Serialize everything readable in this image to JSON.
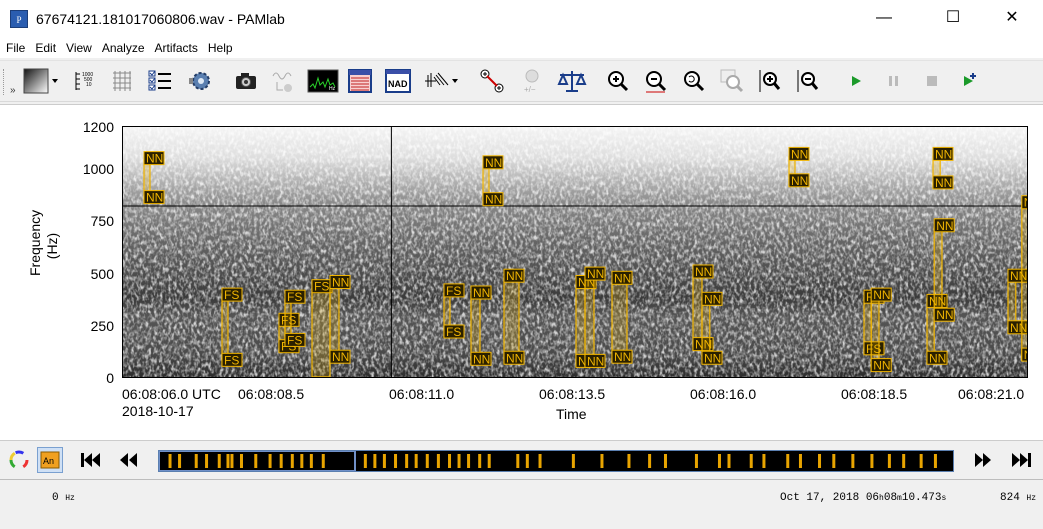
{
  "window": {
    "title": "67674121.181017060806.wav - PAMlab",
    "app_icon": "PAMlab-icon",
    "minimize": "—",
    "maximize": "☐",
    "close": "✕"
  },
  "menu": [
    "File",
    "Edit",
    "View",
    "Analyze",
    "Artifacts",
    "Help"
  ],
  "toolbar": [
    "colormap-icon",
    "scale-icon",
    "grid-icon",
    "checklist-icon",
    "settings-gear-icon",
    "camera-icon",
    "waveform-icon",
    "spectrum-icon",
    "table-icon",
    "NAD",
    "filter-icon",
    "measure-icon",
    "add-subtract-icon",
    "balance-icon",
    "zoom-in-icon",
    "zoom-out-icon",
    "zoom-reset-icon",
    "zoom-box-icon",
    "zoom-in-time-icon",
    "zoom-out-time-icon",
    "play-icon",
    "pause-icon",
    "stop-icon",
    "play-annotate-icon"
  ],
  "axes": {
    "ylabel_line1": "Frequency",
    "ylabel_line2": "(Hz)",
    "yticks": [
      "1200",
      "1000",
      "750",
      "500",
      "250",
      "0"
    ],
    "xticks": [
      "06:08:06.0 UTC",
      "06:08:08.5",
      "06:08:11.0",
      "06:08:13.5",
      "06:08:16.0",
      "06:08:18.5",
      "06:08:21.0"
    ],
    "date": "2018-10-17",
    "xlabel": "Time"
  },
  "annotations": [
    {
      "t0": 6.35,
      "t1": 6.45,
      "f0": 840,
      "f1": 1040,
      "top": "NN",
      "bottom": "NN"
    },
    {
      "t0": 7.65,
      "t1": 7.75,
      "f0": 65,
      "f1": 390,
      "top": "FS",
      "bottom": "FS"
    },
    {
      "t0": 8.6,
      "t1": 8.7,
      "f0": 130,
      "f1": 270,
      "top": "FS",
      "bottom": "FS"
    },
    {
      "t0": 8.7,
      "t1": 8.8,
      "f0": 160,
      "f1": 380,
      "top": "FS",
      "bottom": "FS"
    },
    {
      "t0": 9.15,
      "t1": 9.45,
      "f0": 10,
      "f1": 430,
      "top": "FS",
      "bottom": ""
    },
    {
      "t0": 9.45,
      "t1": 9.6,
      "f0": 80,
      "f1": 450,
      "top": "NN",
      "bottom": "NN"
    },
    {
      "t0": 11.35,
      "t1": 11.45,
      "f0": 200,
      "f1": 410,
      "top": "FS",
      "bottom": "FS"
    },
    {
      "t0": 11.8,
      "t1": 11.95,
      "f0": 70,
      "f1": 400,
      "top": "NN",
      "bottom": "NN"
    },
    {
      "t0": 12.0,
      "t1": 12.1,
      "f0": 830,
      "f1": 1020,
      "top": "NN",
      "bottom": "NN"
    },
    {
      "t0": 12.35,
      "t1": 12.6,
      "f0": 75,
      "f1": 480,
      "top": "NN",
      "bottom": "NN"
    },
    {
      "t0": 13.55,
      "t1": 13.7,
      "f0": 60,
      "f1": 450,
      "top": "NN",
      "bottom": "NN"
    },
    {
      "t0": 13.7,
      "t1": 13.85,
      "f0": 60,
      "f1": 490,
      "top": "NN",
      "bottom": "NN"
    },
    {
      "t0": 14.15,
      "t1": 14.4,
      "f0": 80,
      "f1": 470,
      "top": "NN",
      "bottom": "NN"
    },
    {
      "t0": 15.5,
      "t1": 15.65,
      "f0": 140,
      "f1": 500,
      "top": "NN",
      "bottom": "NN"
    },
    {
      "t0": 15.65,
      "t1": 15.78,
      "f0": 75,
      "f1": 370,
      "top": "NN",
      "bottom": "NN"
    },
    {
      "t0": 17.1,
      "t1": 17.2,
      "f0": 920,
      "f1": 1060,
      "top": "NN",
      "bottom": "NN"
    },
    {
      "t0": 18.35,
      "t1": 18.47,
      "f0": 120,
      "f1": 380,
      "top": "FS",
      "bottom": "FS"
    },
    {
      "t0": 18.47,
      "t1": 18.6,
      "f0": 40,
      "f1": 390,
      "top": "NN",
      "bottom": "NN"
    },
    {
      "t0": 19.4,
      "t1": 19.52,
      "f0": 75,
      "f1": 360,
      "top": "NN",
      "bottom": "NN"
    },
    {
      "t0": 19.52,
      "t1": 19.65,
      "f0": 280,
      "f1": 720,
      "top": "NN",
      "bottom": "NN"
    },
    {
      "t0": 19.5,
      "t1": 19.62,
      "f0": 910,
      "f1": 1060,
      "top": "NN",
      "bottom": "NN"
    },
    {
      "t0": 20.75,
      "t1": 20.88,
      "f0": 220,
      "f1": 480,
      "top": "NN",
      "bottom": "NN"
    },
    {
      "t0": 20.98,
      "t1": 21.12,
      "f0": 90,
      "f1": 830,
      "top": "NN",
      "bottom": "NN"
    }
  ],
  "timeline_marks": [
    0.012,
    0.024,
    0.045,
    0.058,
    0.074,
    0.085,
    0.09,
    0.102,
    0.12,
    0.138,
    0.152,
    0.166,
    0.178,
    0.19,
    0.205,
    0.258,
    0.27,
    0.282,
    0.296,
    0.31,
    0.322,
    0.336,
    0.35,
    0.364,
    0.376,
    0.388,
    0.402,
    0.414,
    0.45,
    0.462,
    0.478,
    0.52,
    0.556,
    0.59,
    0.616,
    0.636,
    0.675,
    0.704,
    0.716,
    0.744,
    0.76,
    0.79,
    0.806,
    0.83,
    0.848,
    0.872,
    0.896,
    0.918,
    0.936,
    0.958,
    0.976
  ],
  "status": {
    "freq_left_value": "0",
    "freq_left_unit": "Hz",
    "datetime": "Oct 17, 2018 06",
    "h": "h",
    "min": "08",
    "m": "m",
    "sec": "10.473",
    "s": "s",
    "freq_right_value": "824",
    "freq_right_unit": "Hz"
  },
  "colors": {
    "annotation": "#f0b400",
    "label_bg": "#2a2000",
    "timeline_mark": "#e8a400"
  }
}
